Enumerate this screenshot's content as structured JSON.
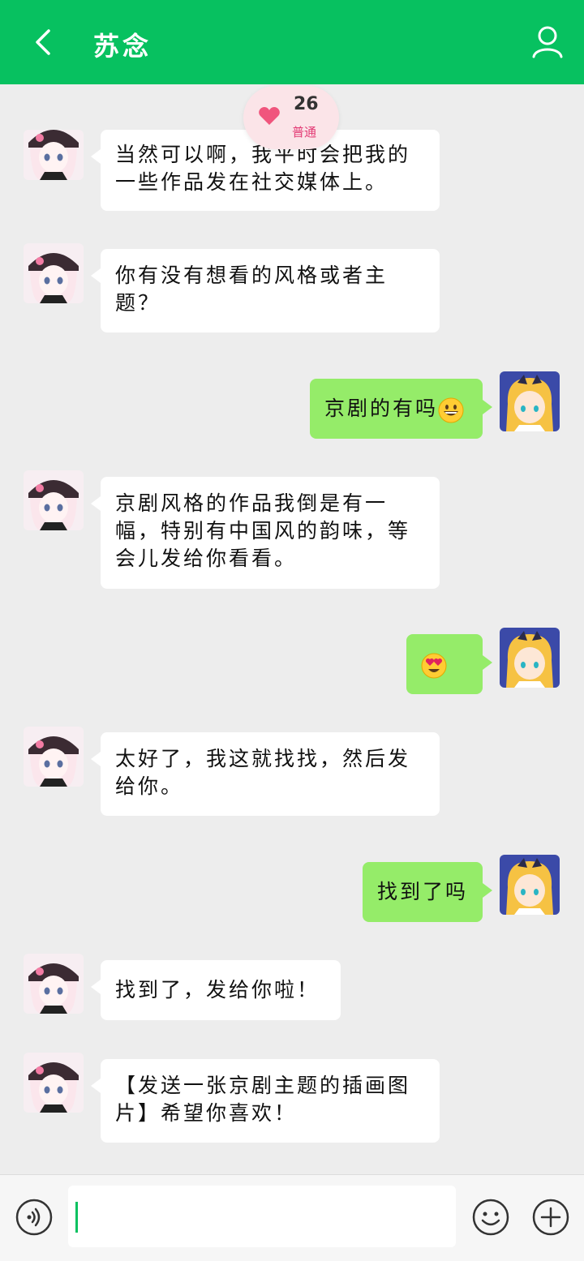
{
  "header": {
    "title": "苏念"
  },
  "affinity": {
    "count": "26",
    "level": "普通"
  },
  "messages": [
    {
      "side": "left",
      "text": "当然可以啊，我平时会把我的一些作品发在社交媒体上。"
    },
    {
      "side": "left",
      "text": "你有没有想看的风格或者主题？"
    },
    {
      "side": "right",
      "text": "京剧的有吗",
      "emoji": "grinning-face"
    },
    {
      "side": "left",
      "text": "京剧风格的作品我倒是有一幅，特别有中国风的韵味，等会儿发给你看看。"
    },
    {
      "side": "right",
      "text": "",
      "emoji": "heart-eyes-face"
    },
    {
      "side": "left",
      "text": "太好了，我这就找找，然后发给你。"
    },
    {
      "side": "right",
      "text": "找到了吗"
    },
    {
      "side": "left",
      "text": "找到了，发给你啦！"
    },
    {
      "side": "left",
      "text": "【发送一张京剧主题的插画图片】希望你喜欢！"
    }
  ],
  "input": {
    "value": "",
    "placeholder": ""
  },
  "icons": {
    "back": "back-arrow-icon",
    "profile": "person-icon",
    "heart": "heart-icon",
    "voice": "voice-icon",
    "emoji": "smiley-icon",
    "plus": "plus-icon"
  },
  "colors": {
    "header": "#07c160",
    "bubble_self": "#95ec69",
    "bubble_other": "#ffffff",
    "background": "#ededed",
    "heart": "#f0557d"
  }
}
